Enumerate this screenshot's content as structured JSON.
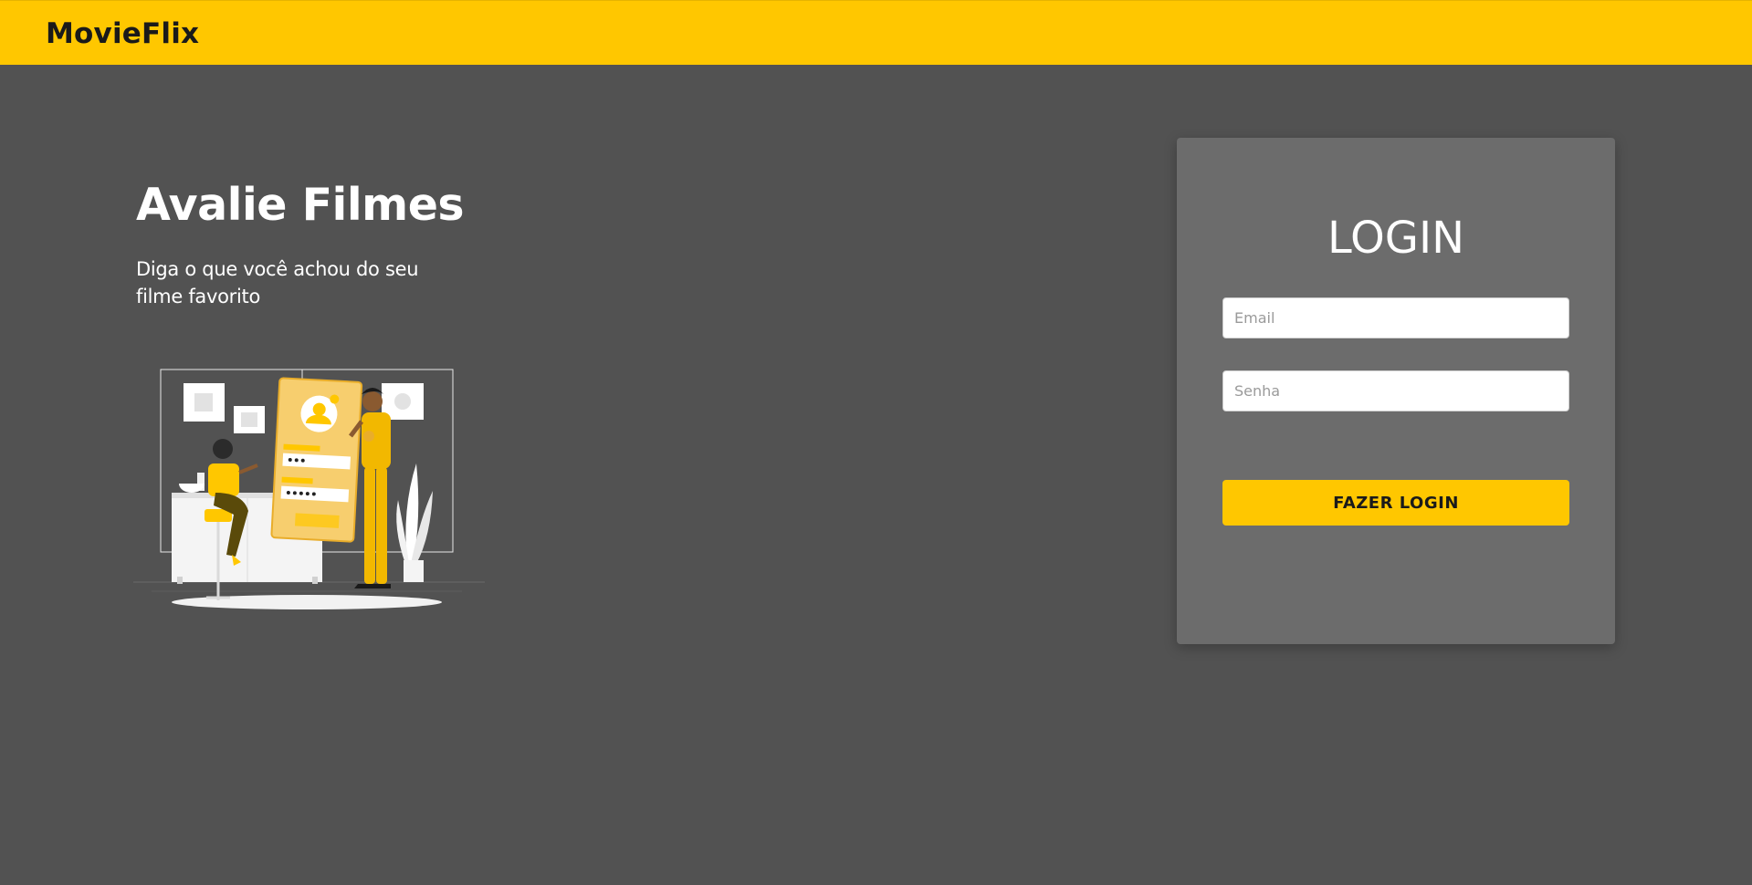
{
  "navbar": {
    "brand": "MovieFlix",
    "background_color": "#FFC700"
  },
  "hero": {
    "title": "Avalie Filmes",
    "subtitle": "Diga o que você achou do seu filme favorito",
    "illustration_icon": "login-illustration"
  },
  "login": {
    "title": "LOGIN",
    "email_placeholder": "Email",
    "password_placeholder": "Senha",
    "submit_label": "FAZER LOGIN"
  },
  "colors": {
    "accent": "#FFC700",
    "page_background": "#525252",
    "card_background": "#6c6c6c"
  }
}
